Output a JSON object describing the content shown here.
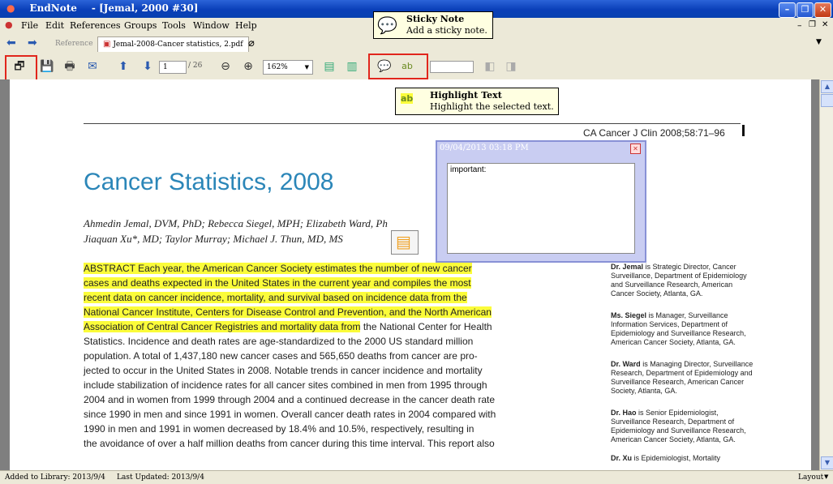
{
  "window": {
    "app_name": "EndNote",
    "title": "- [Jemal, 2000 #30]"
  },
  "menu": [
    "File",
    "Edit",
    "References",
    "Groups",
    "Tools",
    "Window",
    "Help"
  ],
  "tabs": {
    "reference": "Reference",
    "pdf": "Jemal-2008-Cancer statistics, 2.pdf"
  },
  "toolbar": {
    "page_current": "1",
    "page_total": "/ 26",
    "zoom": "162%"
  },
  "tooltips": {
    "sticky_note": {
      "title": "Sticky Note",
      "desc": "Add a sticky note."
    },
    "highlight": {
      "title": "Highlight Text",
      "desc": "Highlight the selected text."
    }
  },
  "document": {
    "journal_ref": "CA Cancer J Clin 2008;58:71–96",
    "title": "Cancer Statistics, 2008",
    "authors_line1": "Ahmedin Jemal, DVM, PhD; Rebecca Siegel, MPH; Elizabeth Ward, Ph",
    "authors_line2": "Jiaquan Xu*, MD; Taylor Murray; Michael J. Thun, MD, MS",
    "abstract_highlighted": [
      "ABSTRACT   Each year, the American Cancer Society estimates the number of new cancer",
      "cases and deaths expected in the United States in the current year and compiles the most",
      "recent data on cancer incidence, mortality, and survival based on incidence data from the",
      "National Cancer Institute, Centers for Disease Control and Prevention, and the North American",
      "Association of Central Cancer Registries and mortality data from"
    ],
    "abstract_line5_rest": " the National Center for Health",
    "abstract_plain": [
      "Statistics. Incidence and death rates are age-standardized to the 2000 US standard million",
      "population. A total of 1,437,180 new cancer cases and 565,650 deaths from cancer are pro-",
      "jected to occur in the United States in 2008. Notable trends in cancer incidence and mortality",
      "include stabilization of incidence rates for all cancer sites combined in men from 1995 through",
      "2004 and in women from 1999 through 2004 and a continued decrease in the cancer death rate",
      "since 1990 in men and since 1991 in women. Overall cancer death rates in 2004 compared with",
      "1990 in men and 1991 in women decreased by 18.4% and 10.5%, respectively, resulting in",
      "the avoidance of over a half million deaths from cancer during this time interval. This report also"
    ],
    "bios": [
      {
        "name": "Dr. Jemal",
        "text": " is Strategic Director, Cancer Surveillance, Department of Epidemiology and Surveillance Research, American Cancer Society, Atlanta, GA."
      },
      {
        "name": "Ms. Siegel",
        "text": " is Manager, Surveillance Information Services, Department of Epidemiology and Surveillance Research, American Cancer Society, Atlanta, GA."
      },
      {
        "name": "Dr. Ward",
        "text": " is Managing Director, Surveillance Research, Department of Epidemiology and Surveillance Research, American Cancer Society, Atlanta, GA."
      },
      {
        "name": "Dr. Hao",
        "text": " is Senior Epidemiologist, Surveillance Research, Department of Epidemiology and Surveillance Research, American Cancer Society, Atlanta, GA."
      },
      {
        "name": "Dr. Xu",
        "text": " is Epidemiologist, Mortality"
      }
    ]
  },
  "sticky_note": {
    "timestamp": "09/04/2013 03:18 PM",
    "content": "important:"
  },
  "status": {
    "added": "Added to Library: 2013/9/4",
    "updated": "Last Updated: 2013/9/4",
    "layout": "Layout"
  },
  "colors": {
    "highlight": "#fbfc3a",
    "title_blue": "#2b86b8",
    "callout_red": "#e1261c"
  }
}
